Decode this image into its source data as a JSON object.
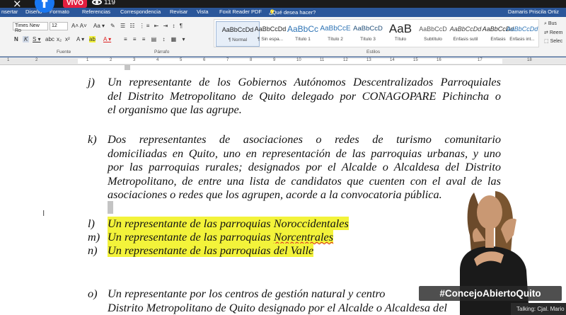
{
  "overlay": {
    "close_glyph": "×",
    "facebook_glyph": "f",
    "live_label": "VIVO",
    "viewer_count": "119",
    "hashtag": "#ConcejoAbiertoQuito",
    "lower_third": "Talking: Cjal. Mario"
  },
  "ribbon": {
    "tabs": [
      "nsertar",
      "Diseño",
      "Formato",
      "Referencias",
      "Correspondencia",
      "Revisar",
      "Vista",
      "Foxit Reader PDF"
    ],
    "tell_me": "¿Qué desea hacer?",
    "user": "Damaris Priscila Ortiz",
    "font_name": "Times New Ro",
    "font_size": "12",
    "groups": {
      "font": "Fuente",
      "paragraph": "Párrafo",
      "styles": "Estilos"
    },
    "styles": [
      {
        "sample": "AaBbCcDd",
        "name": "¶ Normal"
      },
      {
        "sample": "AaBbCcDd",
        "name": "¶ Sin espa..."
      },
      {
        "sample": "AaBbCc",
        "name": "Título 1"
      },
      {
        "sample": "AaBbCcE",
        "name": "Título 2"
      },
      {
        "sample": "AaBbCcD",
        "name": "Título 3"
      },
      {
        "sample": "AaB",
        "name": "Título"
      },
      {
        "sample": "AaBbCcD",
        "name": "Subtítulo"
      },
      {
        "sample": "AaBbCcDd",
        "name": "Énfasis sutil"
      },
      {
        "sample": "AaBbCcDd",
        "name": "Énfasis"
      },
      {
        "sample": "AaBbCcDd",
        "name": "Énfasis int..."
      }
    ],
    "edit": [
      "Bus",
      "Reem",
      "Selec"
    ],
    "colors": {
      "tab_bg": "#2b579a",
      "highlight": "#f3f33a",
      "font_red": "#d22"
    }
  },
  "ruler": {
    "numbers": [
      "1",
      "2",
      "1",
      "2",
      "3",
      "4",
      "5",
      "6",
      "7",
      "8",
      "9",
      "10",
      "11",
      "12",
      "13",
      "14",
      "15",
      "16",
      "17",
      "18"
    ]
  },
  "document": {
    "j": {
      "letter": "j)",
      "lines": [
        "Un representante de los Gobiernos Autónomos Descentralizados Parroquiales",
        "del Distrito Metropolitano de Quito delegado por CONAGOPARE Pichincha o",
        "el organismo que las agrupe."
      ]
    },
    "k": {
      "letter": "k)",
      "lines": [
        "Dos representantes de asociaciones o redes de turismo comunitario",
        "domiciliadas en Quito, uno en representación de las parroquias urbanas, y uno",
        "por las parroquias rurales; designados por el Alcalde o Alcaldesa del Distrito",
        "Metropolitano, de entre una lista de candidatos que cuenten con el aval de las",
        "asociaciones o redes que los agrupen, acorde a la convocatoria pública."
      ]
    },
    "l": {
      "letter": "l)",
      "text": "Un representante de las parroquias Noroccidentales"
    },
    "m": {
      "letter": "m)",
      "text_before": "Un representante de las parroquias ",
      "text_misspelled": "Norcentrales"
    },
    "n": {
      "letter": "n)",
      "text": "Un representante de las parroquias del Valle"
    },
    "o": {
      "letter": "o)",
      "lines": [
        "Un representante por los centros de gestión natural y centro",
        "Distrito Metropolitano de Quito designado por el Alcalde o Alcaldesa del"
      ]
    }
  }
}
